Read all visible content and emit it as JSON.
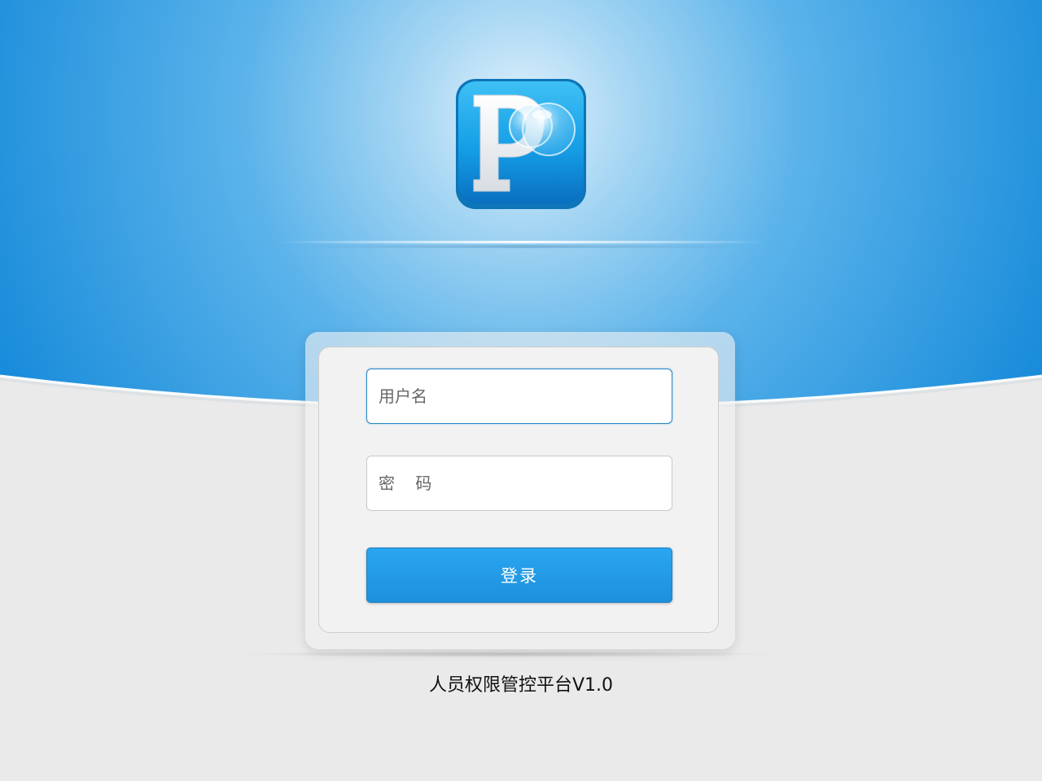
{
  "login": {
    "username_placeholder": "用户名",
    "password_placeholder": "密    码",
    "submit_label": "登录"
  },
  "footer": {
    "title": "人员权限管控平台V1.0"
  },
  "logo": {
    "letter": "P",
    "icon": "app-logo-icon"
  },
  "colors": {
    "accent": "#1a8edb",
    "header_blue": "#1a8edb",
    "background_gray": "#eaeaea",
    "button_top": "#2aa6f0",
    "button_bottom": "#1e90dc"
  }
}
